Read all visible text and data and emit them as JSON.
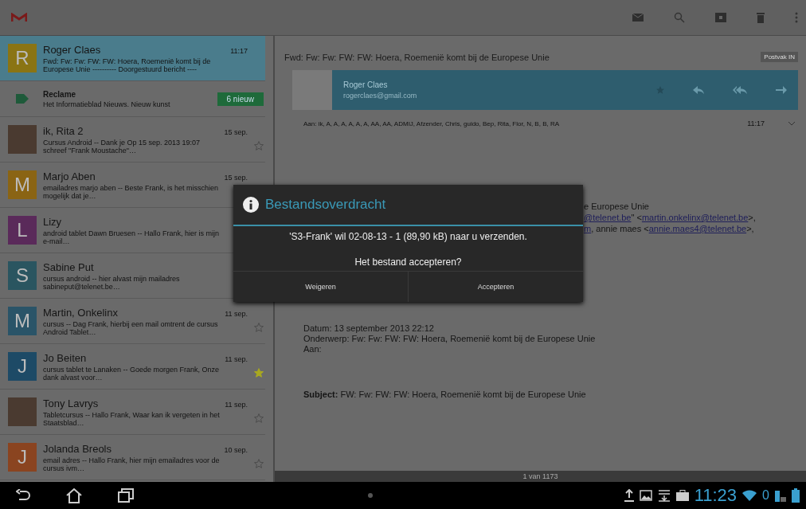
{
  "conversations": [
    {
      "kind": "mail",
      "sender": "Roger Claes",
      "time": "11:17",
      "snippet": "Fwd: Fw: Fw: FW: FW: Hoera, Roemenië komt bij de Europese Unie ---------- Doorgestuurd bericht ----",
      "avatar": "R",
      "color": "#8a7414",
      "selected": true
    },
    {
      "kind": "ad",
      "sender": "Reclame",
      "snippet": "Het Informatieblad Nieuws. Nieuw kunst",
      "button": "6 nieuw",
      "selected": false
    },
    {
      "kind": "mail",
      "sender": "ik, Rita  2",
      "time": "15 sep.",
      "snippet": "Cursus Android -- Dank je Op 15 sep. 2013 19:07 schreef \"Frank Moustache\"…",
      "selected": false,
      "starred": false
    },
    {
      "kind": "mail",
      "sender": "Marjo Aben",
      "time": "15 sep.",
      "snippet": "emailadres marjo aben -- Beste Frank, is het misschien mogelijk dat je…",
      "avatar": "M",
      "color": "#8a6414",
      "selected": false
    },
    {
      "kind": "mail",
      "sender": "Lizy",
      "snippet": "android tablet Dawn Bruesen -- Hallo Frank, hier is mijn e-mail…",
      "avatar": "L",
      "color": "#5a2a5a",
      "selected": false
    },
    {
      "kind": "mail",
      "sender": "Sabine Put",
      "snippet": "cursus android -- hier alvast mijn mailadres sabineput@telenet.be…",
      "avatar": "S",
      "color": "#2a5560",
      "selected": false
    },
    {
      "kind": "mail",
      "sender": "Martin, Onkelinx",
      "time": "11 sep.",
      "snippet": "cursus -- Dag Frank, hierbij een mail omtrent de cursus Android Tablet…",
      "avatar": "M",
      "color": "#2a5468",
      "selected": false,
      "starred": false
    },
    {
      "kind": "mail",
      "sender": "Jo Beiten",
      "time": "11 sep.",
      "snippet": "cursus tablet te Lanaken -- Goede morgen Frank, Onze dank alvast voor…",
      "avatar": "J",
      "color": "#1d4a66",
      "selected": false,
      "starred": true
    },
    {
      "kind": "mail",
      "sender": "Tony Lavrys",
      "time": "11 sep.",
      "snippet": "Tabletcursus -- Hallo Frank, Waar kan ik vergeten in het Staatsblad…",
      "selected": false,
      "starred": false
    },
    {
      "kind": "mail",
      "sender": "Jolanda Breols",
      "time": "10 sep.",
      "snippet": "email adres -- Hallo Frank, hier mijn emailadres voor de cursus ivm…",
      "avatar": "J",
      "color": "#8a4420",
      "selected": false,
      "starred": false
    }
  ],
  "message": {
    "subject": "Fwd: Fw: Fw: FW: FW: Hoera, Roemenië komt bij de Europese Unie",
    "label": "Postvak IN",
    "sender": "Roger Claes",
    "email": "rogerclaes@gmail.com",
    "recipients": "Aan: ik, A, A, A, A, A, A, AA, AA, ADMIJ, Afzender, Chris, guido, Bep, Rita, Flor, N, B, B, RA",
    "time": "11:17",
    "fragments": [
      {
        "kind": "text",
        "text": "e Europese Unie"
      },
      {
        "kind": "links",
        "parts": [
          {
            "kind": "link",
            "text": "@telenet.be"
          },
          {
            "kind": "text",
            "text": "\" <"
          },
          {
            "kind": "link",
            "text": "martin.onkelinx@telenet.be"
          },
          {
            "kind": "text",
            "text": ">,"
          }
        ]
      },
      {
        "kind": "links",
        "parts": [
          {
            "kind": "link",
            "text": "m"
          },
          {
            "kind": "text",
            "text": ", annie maes <"
          },
          {
            "kind": "link",
            "text": "annie.maes4@telenet.be"
          },
          {
            "kind": "text",
            "text": ">,"
          }
        ]
      }
    ],
    "headers": [
      "Datum: 13 september 2013 22:12",
      "Onderwerp: Fw: Fw: FW: FW: Hoera, Roemenië komt bij de Europese Unie",
      "Aan:"
    ],
    "subject_line": "**Subject:** FW: Fw: FW: FW: Hoera, Roemenië komt bij de Europese Unie",
    "pager": "1 van 1173"
  },
  "dialog": {
    "title": "Bestandsoverdracht",
    "text": "'S3-Frank' wil 02-08-13 - 1 (89,90 kB) naar u verzenden.",
    "question": "Het bestand accepteren?",
    "buttons": [
      "Weigeren",
      "Accepteren"
    ]
  },
  "system_bar": {
    "time": "11:23",
    "notification_count": "0"
  }
}
